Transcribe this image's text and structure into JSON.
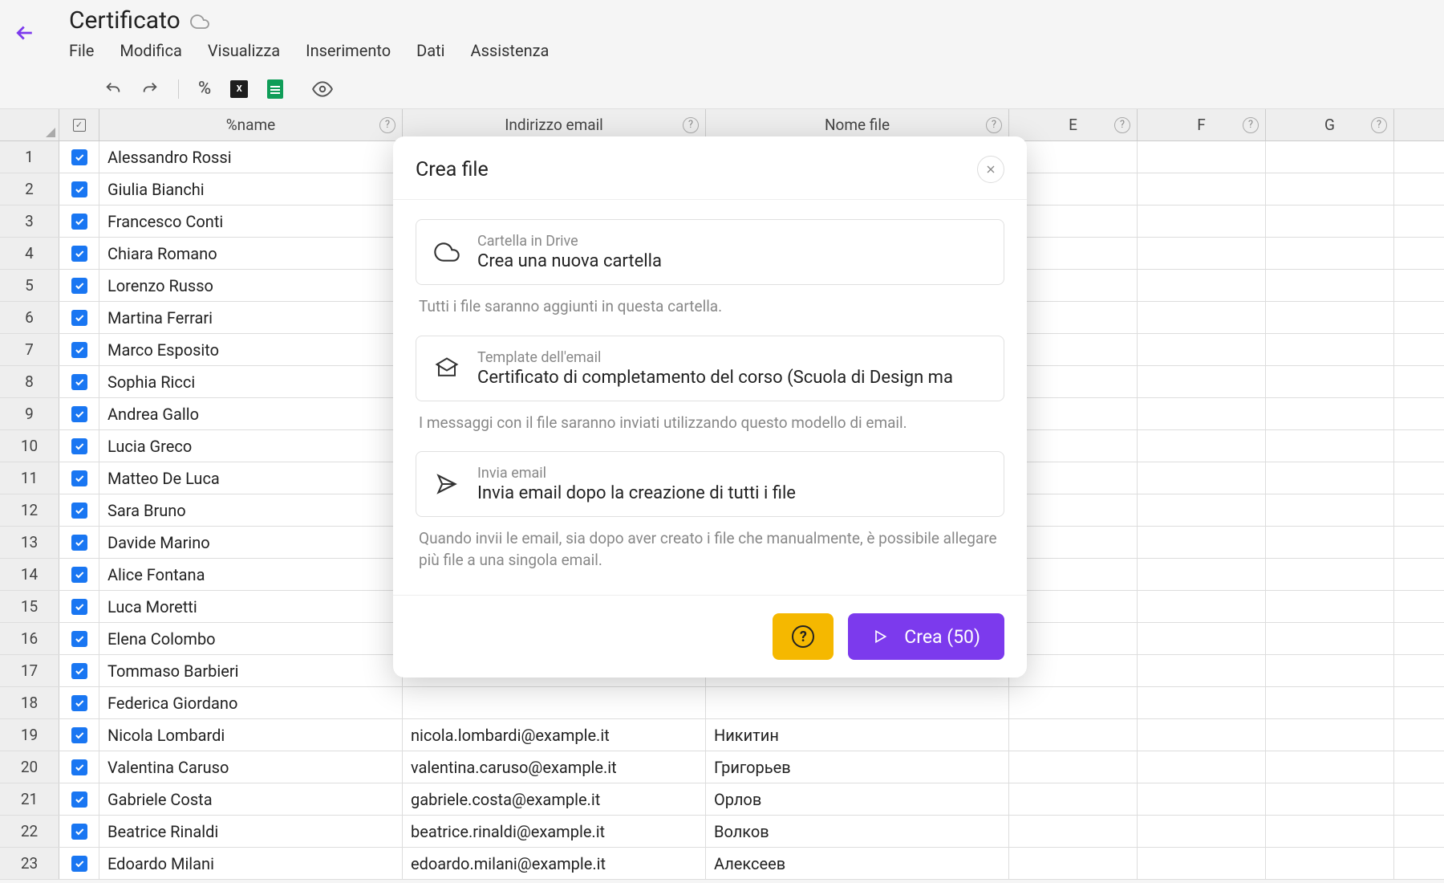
{
  "doc_title": "Certificato",
  "menu": {
    "file": "File",
    "modifica": "Modifica",
    "visualizza": "Visualizza",
    "inserimento": "Inserimento",
    "dati": "Dati",
    "assistenza": "Assistenza"
  },
  "columns": {
    "b": "%name",
    "c": "Indirizzo email",
    "d": "Nome file",
    "e": "E",
    "f": "F",
    "g": "G"
  },
  "rows": [
    {
      "n": "1",
      "name": "Alessandro Rossi",
      "email": "",
      "file": ""
    },
    {
      "n": "2",
      "name": "Giulia Bianchi",
      "email": "",
      "file": ""
    },
    {
      "n": "3",
      "name": "Francesco Conti",
      "email": "",
      "file": ""
    },
    {
      "n": "4",
      "name": "Chiara Romano",
      "email": "",
      "file": ""
    },
    {
      "n": "5",
      "name": "Lorenzo Russo",
      "email": "",
      "file": ""
    },
    {
      "n": "6",
      "name": "Martina Ferrari",
      "email": "",
      "file": ""
    },
    {
      "n": "7",
      "name": "Marco Esposito",
      "email": "",
      "file": ""
    },
    {
      "n": "8",
      "name": "Sophia Ricci",
      "email": "",
      "file": ""
    },
    {
      "n": "9",
      "name": "Andrea Gallo",
      "email": "",
      "file": ""
    },
    {
      "n": "10",
      "name": "Lucia Greco",
      "email": "",
      "file": ""
    },
    {
      "n": "11",
      "name": "Matteo De Luca",
      "email": "",
      "file": ""
    },
    {
      "n": "12",
      "name": "Sara Bruno",
      "email": "",
      "file": ""
    },
    {
      "n": "13",
      "name": "Davide Marino",
      "email": "",
      "file": ""
    },
    {
      "n": "14",
      "name": "Alice Fontana",
      "email": "",
      "file": ""
    },
    {
      "n": "15",
      "name": "Luca Moretti",
      "email": "",
      "file": ""
    },
    {
      "n": "16",
      "name": "Elena Colombo",
      "email": "",
      "file": ""
    },
    {
      "n": "17",
      "name": "Tommaso Barbieri",
      "email": "",
      "file": ""
    },
    {
      "n": "18",
      "name": "Federica Giordano",
      "email": "",
      "file": ""
    },
    {
      "n": "19",
      "name": "Nicola Lombardi",
      "email": "nicola.lombardi@example.it",
      "file": "Никитин"
    },
    {
      "n": "20",
      "name": "Valentina Caruso",
      "email": "valentina.caruso@example.it",
      "file": "Григорьев"
    },
    {
      "n": "21",
      "name": "Gabriele Costa",
      "email": "gabriele.costa@example.it",
      "file": "Орлов"
    },
    {
      "n": "22",
      "name": "Beatrice Rinaldi",
      "email": "beatrice.rinaldi@example.it",
      "file": "Волков"
    },
    {
      "n": "23",
      "name": "Edoardo Milani",
      "email": "edoardo.milani@example.it",
      "file": "Алексеев"
    }
  ],
  "modal": {
    "title": "Crea file",
    "drive_label": "Cartella in Drive",
    "drive_value": "Crea una nuova cartella",
    "drive_desc": "Tutti i file saranno aggiunti in questa cartella.",
    "template_label": "Template dell'email",
    "template_value": "Certificato di completamento del corso (Scuola di Design ma",
    "template_desc": "I messaggi con il file saranno inviati utilizzando questo modello di email.",
    "send_label": "Invia email",
    "send_value": "Invia email dopo la creazione di tutti i file",
    "send_desc": "Quando invii le email, sia dopo aver creato i file che manualmente, è possibile allegare più file a una singola email.",
    "create_btn": "Crea (50)"
  }
}
